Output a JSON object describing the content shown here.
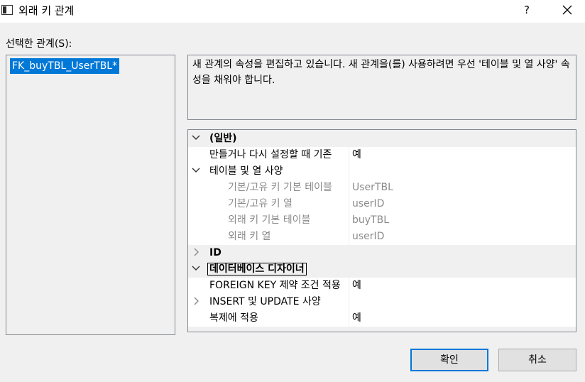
{
  "window": {
    "title": "외래 키 관계",
    "help": "?"
  },
  "relations": {
    "label": "선택한 관계(S):",
    "items": [
      "FK_buyTBL_UserTBL*"
    ]
  },
  "description": "새 관계의 속성을 편집하고 있습니다. 새 관계을(를) 사용하려면 우선 '테이블 및 열 사양' 속성을 채워야 합니다.",
  "properties": {
    "rows": [
      {
        "name": "(일반)",
        "value": ""
      },
      {
        "name": "만들거나 다시 설정할 때 기존",
        "value": "예"
      },
      {
        "name": "테이블 및 열 사양",
        "value": ""
      },
      {
        "name": "기본/고유 키 기본 테이블",
        "value": "UserTBL"
      },
      {
        "name": "기본/고유 키 열",
        "value": "userID"
      },
      {
        "name": "외래 키 기본 테이블",
        "value": "buyTBL"
      },
      {
        "name": "외래 키 열",
        "value": "userID"
      },
      {
        "name": "ID",
        "value": ""
      },
      {
        "name": "데이터베이스 디자이너",
        "value": ""
      },
      {
        "name": "FOREIGN KEY 제약 조건 적용",
        "value": "예"
      },
      {
        "name": "INSERT 및 UPDATE 사양",
        "value": ""
      },
      {
        "name": "복제에 적용",
        "value": "예"
      }
    ]
  },
  "buttons": {
    "ok": "확인",
    "cancel": "취소"
  }
}
